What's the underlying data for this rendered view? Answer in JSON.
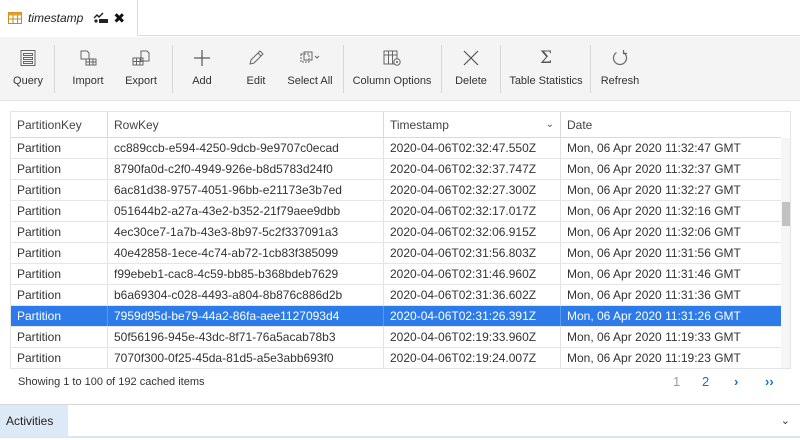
{
  "tab": {
    "title": "timestamp",
    "close_glyph": "✖"
  },
  "toolbar": {
    "buttons": [
      {
        "label": "Query",
        "icon": "query-icon"
      },
      {
        "label": "Import",
        "icon": "import-icon"
      },
      {
        "label": "Export",
        "icon": "export-icon"
      },
      {
        "label": "Add",
        "icon": "add-icon"
      },
      {
        "label": "Edit",
        "icon": "edit-icon"
      },
      {
        "label": "Select All",
        "icon": "select-all-icon"
      },
      {
        "label": "Column Options",
        "icon": "column-options-icon"
      },
      {
        "label": "Delete",
        "icon": "delete-icon"
      },
      {
        "label": "Table Statistics",
        "icon": "sigma-icon"
      },
      {
        "label": "Refresh",
        "icon": "refresh-icon"
      }
    ]
  },
  "grid": {
    "columns": [
      "PartitionKey",
      "RowKey",
      "Timestamp",
      "Date"
    ],
    "sort_glyph": "⌄",
    "selected_row": 8,
    "rows": [
      [
        "Partition",
        "cc889ccb-e594-4250-9dcb-9e9707c0ecad",
        "2020-04-06T02:32:47.550Z",
        "Mon, 06 Apr 2020 11:32:47 GMT"
      ],
      [
        "Partition",
        "8790fa0d-c2f0-4949-926e-b8d5783d24f0",
        "2020-04-06T02:32:37.747Z",
        "Mon, 06 Apr 2020 11:32:37 GMT"
      ],
      [
        "Partition",
        "6ac81d38-9757-4051-96bb-e21173e3b7ed",
        "2020-04-06T02:32:27.300Z",
        "Mon, 06 Apr 2020 11:32:27 GMT"
      ],
      [
        "Partition",
        "051644b2-a27a-43e2-b352-21f79aee9dbb",
        "2020-04-06T02:32:17.017Z",
        "Mon, 06 Apr 2020 11:32:16 GMT"
      ],
      [
        "Partition",
        "4ec30ce7-1a7b-43e3-8b97-5c2f337091a3",
        "2020-04-06T02:32:06.915Z",
        "Mon, 06 Apr 2020 11:32:06 GMT"
      ],
      [
        "Partition",
        "40e42858-1ece-4c74-ab72-1cb83f385099",
        "2020-04-06T02:31:56.803Z",
        "Mon, 06 Apr 2020 11:31:56 GMT"
      ],
      [
        "Partition",
        "f99ebeb1-cac8-4c59-bb85-b368bdeb7629",
        "2020-04-06T02:31:46.960Z",
        "Mon, 06 Apr 2020 11:31:46 GMT"
      ],
      [
        "Partition",
        "b6a69304-c028-4493-a804-8b876c886d2b",
        "2020-04-06T02:31:36.602Z",
        "Mon, 06 Apr 2020 11:31:36 GMT"
      ],
      [
        "Partition",
        "7959d95d-be79-44a2-86fa-aee1127093d4",
        "2020-04-06T02:31:26.391Z",
        "Mon, 06 Apr 2020 11:31:26 GMT"
      ],
      [
        "Partition",
        "50f56196-945e-43dc-8f71-76a5acab78b3",
        "2020-04-06T02:19:33.960Z",
        "Mon, 06 Apr 2020 11:19:33 GMT"
      ],
      [
        "Partition",
        "7070f300-0f25-45da-81d5-a5e3abb693f0",
        "2020-04-06T02:19:24.007Z",
        "Mon, 06 Apr 2020 11:19:23 GMT"
      ]
    ]
  },
  "footer": {
    "status": "Showing 1 to 100 of 192 cached items",
    "pages": [
      "1",
      "2"
    ],
    "next_glyph": "›",
    "last_glyph": "››"
  },
  "activities": {
    "label": "Activities",
    "chevron": "⌄"
  },
  "colors": {
    "selection": "#2d7be8",
    "link": "#1a6fd6",
    "toolbar_bg": "#f4f4f4",
    "activities_tab": "#dde9f6"
  }
}
